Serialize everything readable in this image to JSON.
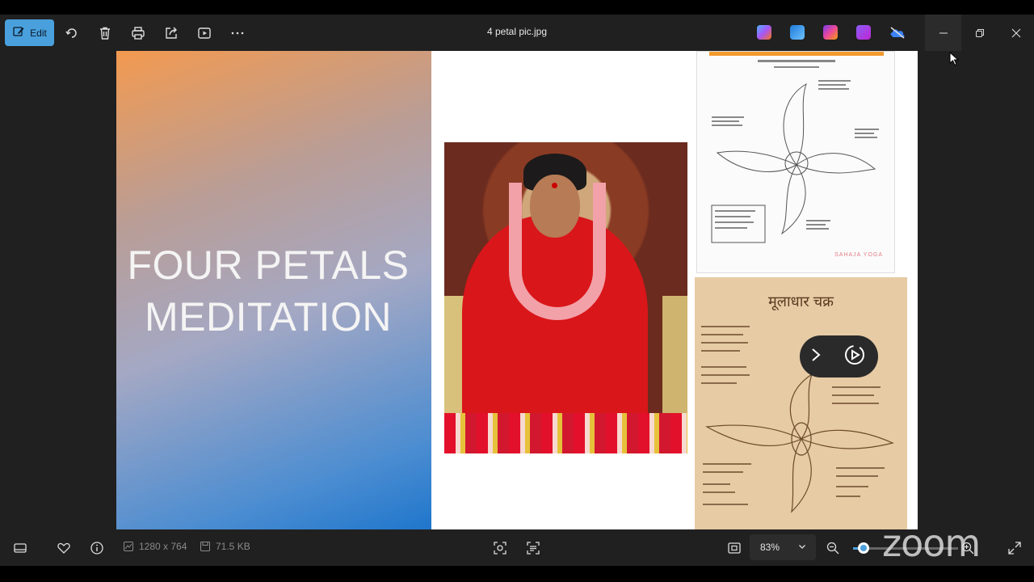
{
  "toolbar": {
    "edit_label": "Edit",
    "file_title": "4 petal pic.jpg",
    "buttons": [
      "rotate-icon",
      "delete-icon",
      "print-icon",
      "share-icon",
      "slideshow-icon",
      "more-icon"
    ],
    "app_icons": [
      {
        "name": "copilot-icon",
        "color": "#7b5cf0"
      },
      {
        "name": "photo-editor-icon",
        "color": "#2f8de4"
      },
      {
        "name": "designer-icon",
        "color": "#e04f9a"
      },
      {
        "name": "clipchamp-icon",
        "color": "#8f3fe0"
      },
      {
        "name": "onedrive-icon",
        "color": "#4aa0dc"
      }
    ]
  },
  "slide": {
    "title_line1": "FOUR PETALS",
    "title_line2": "MEDITATION",
    "diagram_brand": "SAHAJA YOGA",
    "hindi_heading": "मूलाधार चक्र"
  },
  "bottom": {
    "dimensions": "1280 x 764",
    "file_size": "71.5 KB",
    "zoom_value": "83%",
    "zoom_level_fraction": 0.1,
    "watermark": "zoom"
  }
}
